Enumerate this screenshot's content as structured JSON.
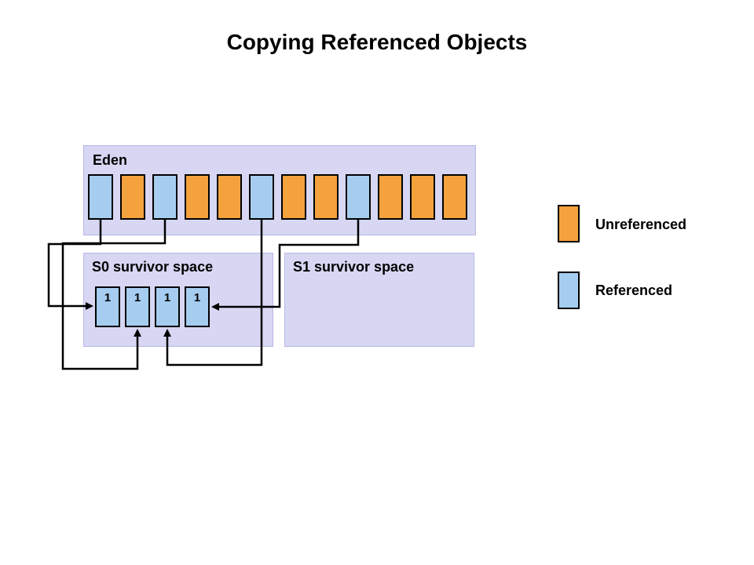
{
  "title": "Copying Referenced Objects",
  "colors": {
    "region_bg": "#d7d7f3",
    "referenced": "#a6cdef",
    "unreferenced": "#f3a23d"
  },
  "eden": {
    "label": "Eden",
    "objects": [
      {
        "state": "referenced"
      },
      {
        "state": "unreferenced"
      },
      {
        "state": "referenced"
      },
      {
        "state": "unreferenced"
      },
      {
        "state": "unreferenced"
      },
      {
        "state": "referenced"
      },
      {
        "state": "unreferenced"
      },
      {
        "state": "unreferenced"
      },
      {
        "state": "referenced"
      },
      {
        "state": "unreferenced"
      },
      {
        "state": "unreferenced"
      },
      {
        "state": "unreferenced"
      }
    ]
  },
  "s0": {
    "label": "S0 survivor space",
    "objects": [
      {
        "age": "1"
      },
      {
        "age": "1"
      },
      {
        "age": "1"
      },
      {
        "age": "1"
      }
    ]
  },
  "s1": {
    "label": "S1 survivor space"
  },
  "legend": {
    "unreferenced": "Unreferenced",
    "referenced": "Referenced"
  },
  "arrows_note": "Each referenced object in Eden is copied to a slot in S0 with age 1."
}
